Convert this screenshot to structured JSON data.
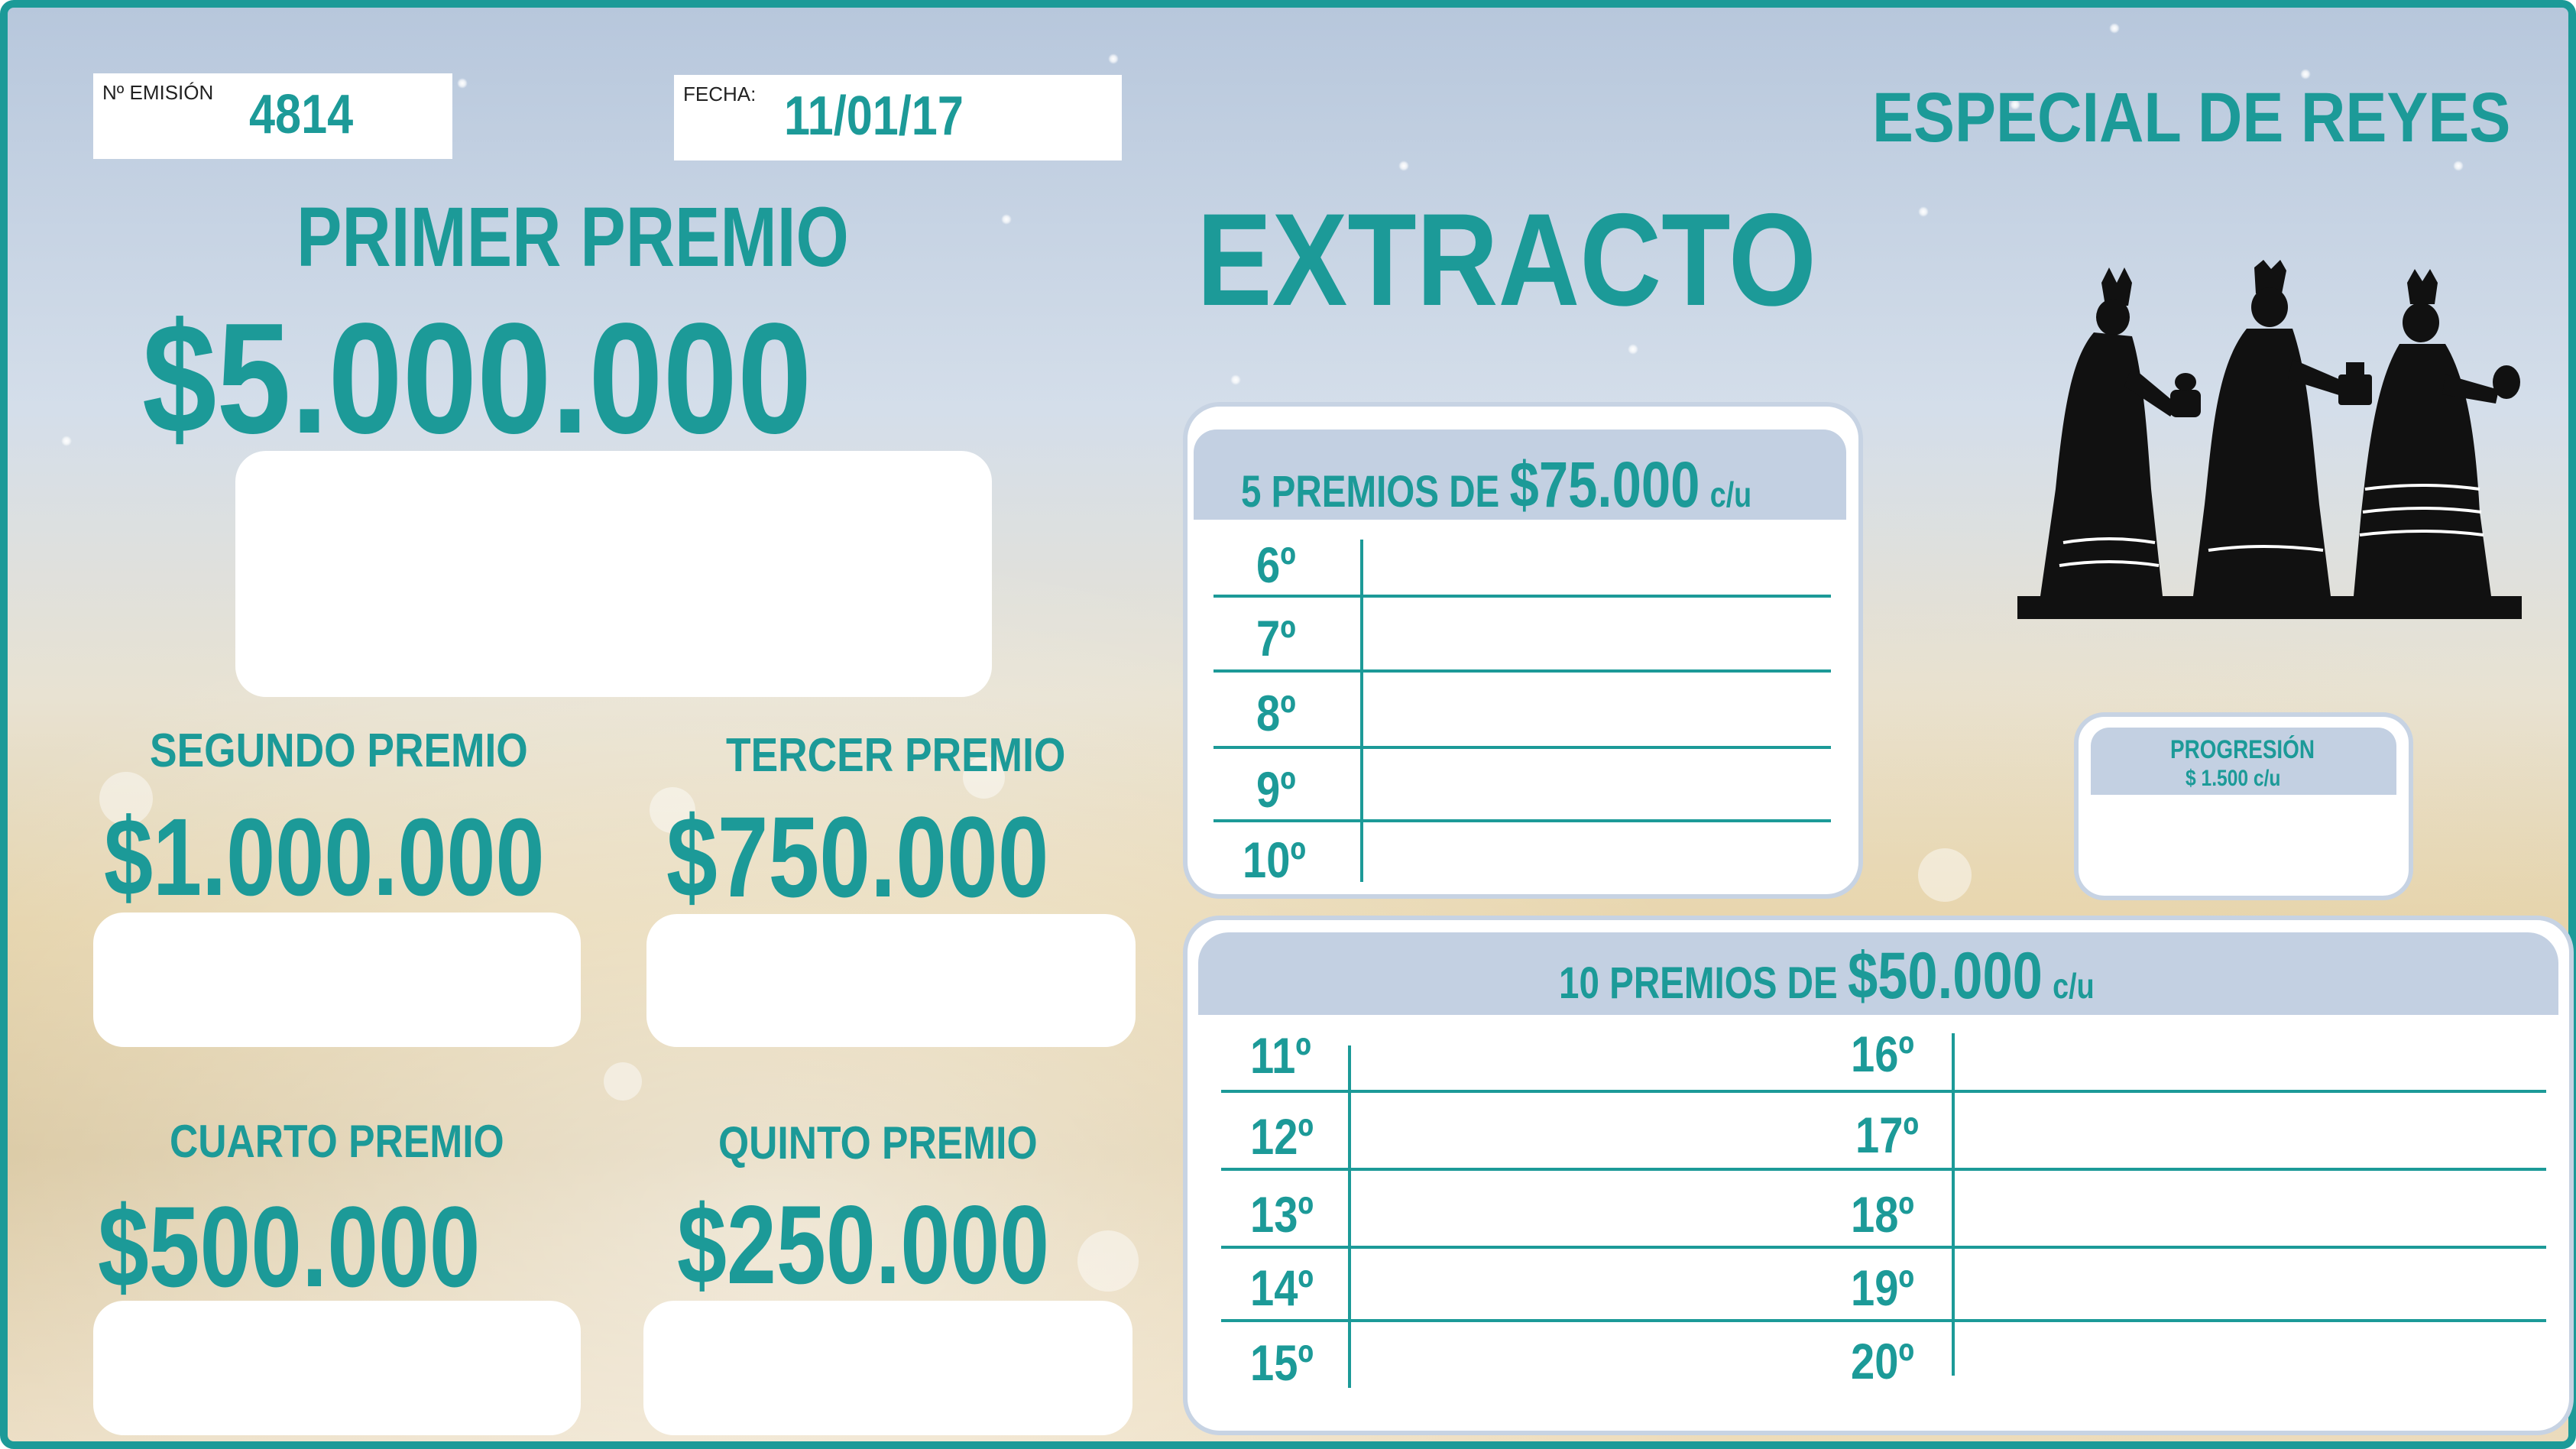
{
  "header": {
    "emision_label": "Nº EMISIÓN",
    "emision_value": "4814",
    "fecha_label": "FECHA:",
    "fecha_value": "11/01/17",
    "special_title": "ESPECIAL DE REYES",
    "extracto_title": "EXTRACTO"
  },
  "prizes": {
    "primer": {
      "label": "PRIMER PREMIO",
      "amount": "$5.000.000"
    },
    "segundo": {
      "label": "SEGUNDO PREMIO",
      "amount": "$1.000.000"
    },
    "tercer": {
      "label": "TERCER PREMIO",
      "amount": "$750.000"
    },
    "cuarto": {
      "label": "CUARTO PREMIO",
      "amount": "$500.000"
    },
    "quinto": {
      "label": "QUINTO PREMIO",
      "amount": "$250.000"
    }
  },
  "panel_75": {
    "prefix": "5 PREMIOS DE",
    "amount": "$75.000",
    "suffix": "c/u",
    "rows": [
      "6º",
      "7º",
      "8º",
      "9º",
      "10º"
    ]
  },
  "panel_50": {
    "prefix": "10 PREMIOS DE",
    "amount": "$50.000",
    "suffix": "c/u",
    "left_rows": [
      "11º",
      "12º",
      "13º",
      "14º",
      "15º"
    ],
    "right_rows": [
      "16º",
      "17º",
      "18º",
      "19º",
      "20º"
    ]
  },
  "progresion": {
    "label": "PROGRESIÓN",
    "price": "$ 1.500 c/u"
  },
  "colors": {
    "accent": "#1c9a98",
    "panel_header": "#c3d0e2"
  },
  "icons": {
    "three_kings": "three-kings-silhouette"
  }
}
